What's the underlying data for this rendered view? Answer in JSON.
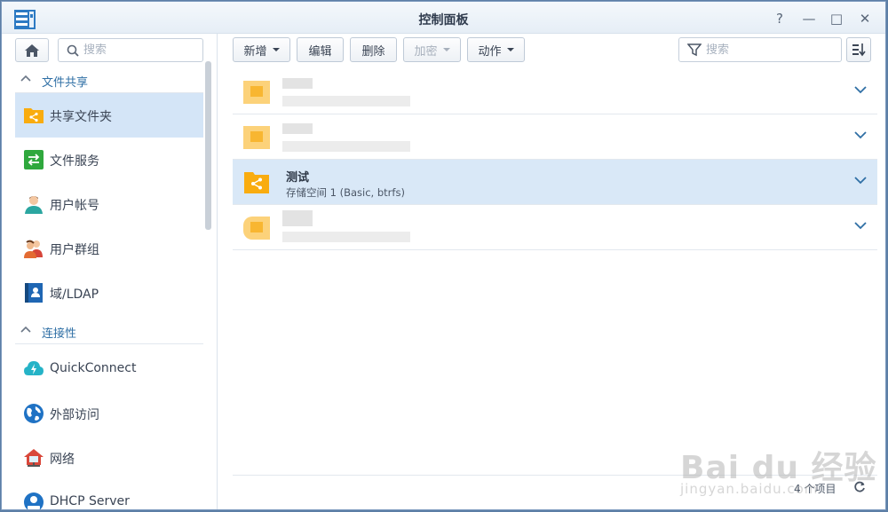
{
  "window": {
    "title": "控制面板",
    "controls": {
      "help": "?",
      "minimize": "—",
      "maximize": "□",
      "close": "✕"
    }
  },
  "sidebar": {
    "search_placeholder": "搜索",
    "sections": [
      {
        "label": "文件共享"
      },
      {
        "label": "连接性"
      }
    ],
    "items": [
      {
        "label": "共享文件夹",
        "active": true,
        "icon": "shared-folder-icon"
      },
      {
        "label": "文件服务",
        "active": false,
        "icon": "file-services-icon"
      },
      {
        "label": "用户帐号",
        "active": false,
        "icon": "user-icon"
      },
      {
        "label": "用户群组",
        "active": false,
        "icon": "group-icon"
      },
      {
        "label": "域/LDAP",
        "active": false,
        "icon": "ldap-icon"
      },
      {
        "label": "QuickConnect",
        "active": false,
        "icon": "quickconnect-icon"
      },
      {
        "label": "外部访问",
        "active": false,
        "icon": "globe-icon"
      },
      {
        "label": "网络",
        "active": false,
        "icon": "network-icon"
      },
      {
        "label": "DHCP Server",
        "active": false,
        "icon": "dhcp-icon"
      }
    ]
  },
  "toolbar": {
    "create": "新增",
    "edit": "编辑",
    "delete": "删除",
    "encrypt": "加密",
    "action": "动作",
    "search_placeholder": "搜索"
  },
  "folders": [
    {
      "name": "",
      "subtitle": "",
      "blurred": true
    },
    {
      "name": "",
      "subtitle": "",
      "blurred": true
    },
    {
      "name": "测试",
      "subtitle": "存储空间 1 (Basic, btrfs)",
      "blurred": false,
      "selected": true
    },
    {
      "name": "",
      "subtitle": "",
      "blurred": true
    }
  ],
  "status": {
    "item_count": "4 个项目"
  },
  "watermark": {
    "brand": "Bai du 经验",
    "url": "jingyan.baidu.com"
  },
  "colors": {
    "accent": "#2f6fa5",
    "selected_row": "#d9e8f7",
    "active_nav": "#d4e5f7",
    "folder": "#f9ac0f"
  }
}
